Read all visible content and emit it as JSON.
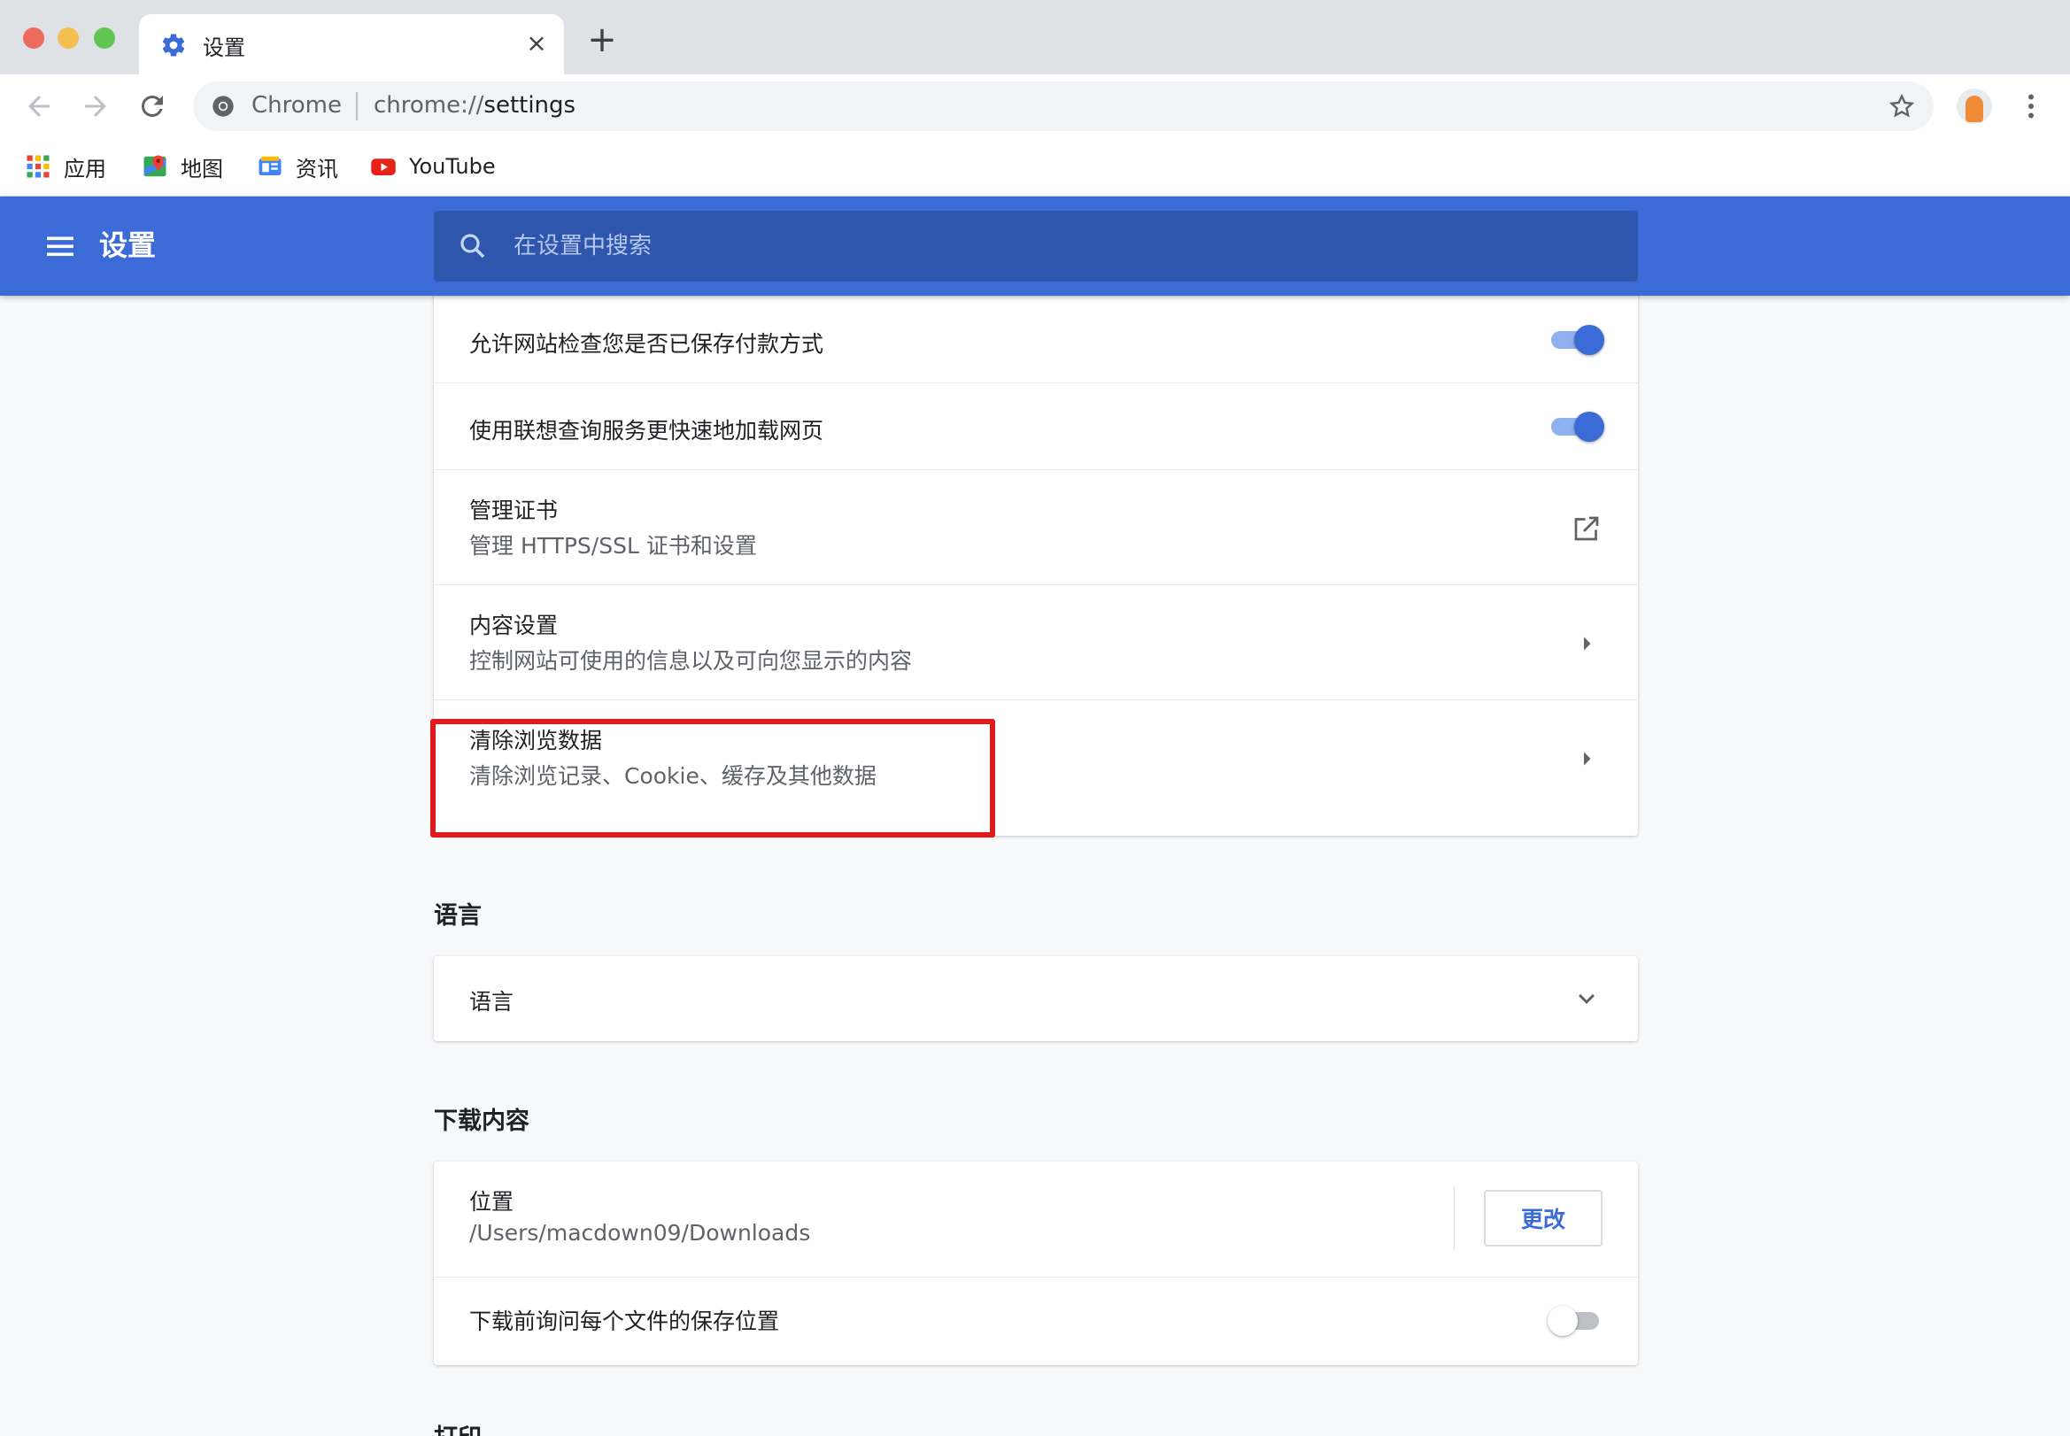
{
  "browser": {
    "tab": {
      "title": "设置",
      "icon": "gear-icon"
    },
    "new_tab_label": "+",
    "close_label": "×",
    "omnibox": {
      "scheme_label": "Chrome",
      "url_prefix": "chrome://",
      "url_host": "settings"
    },
    "bookmarks": [
      {
        "label": "应用",
        "icon": "apps-grid-icon"
      },
      {
        "label": "地图",
        "icon": "maps-icon"
      },
      {
        "label": "资讯",
        "icon": "news-icon"
      },
      {
        "label": "YouTube",
        "icon": "youtube-icon"
      }
    ]
  },
  "header": {
    "title": "设置",
    "search_placeholder": "在设置中搜索"
  },
  "privacy_rows": [
    {
      "title": "允许网站检查您是否已保存付款方式",
      "control": "toggle",
      "state": "on"
    },
    {
      "title": "使用联想查询服务更快速地加载网页",
      "control": "toggle",
      "state": "on"
    },
    {
      "title": "管理证书",
      "subtitle": "管理 HTTPS/SSL 证书和设置",
      "control": "external-link-icon"
    },
    {
      "title": "内容设置",
      "subtitle": "控制网站可使用的信息以及可向您显示的内容",
      "control": "arrow-right-icon"
    },
    {
      "title": "清除浏览数据",
      "subtitle": "清除浏览记录、Cookie、缓存及其他数据",
      "control": "arrow-right-icon",
      "highlighted": true
    }
  ],
  "language_section": {
    "heading": "语言",
    "row_label": "语言",
    "control": "chevron-down-icon"
  },
  "downloads_section": {
    "heading": "下载内容",
    "location_label": "位置",
    "location_path": "/Users/macdown09/Downloads",
    "change_button": "更改",
    "ask_label": "下载前询问每个文件的保存位置",
    "ask_state": "off"
  },
  "next_section_heading": "打印",
  "colors": {
    "header_blue": "#3b6bd6",
    "search_blue": "#2f56ad",
    "highlight_red": "#e0191f",
    "toggle_on": "#3b6bd6"
  }
}
